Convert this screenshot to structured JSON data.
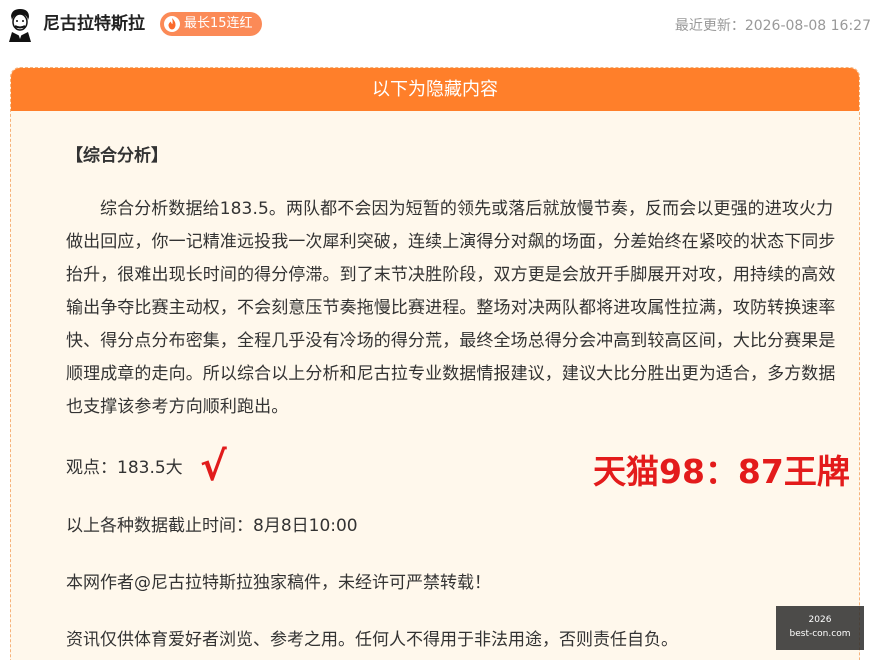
{
  "header": {
    "author_name": "尼古拉特斯拉",
    "streak_badge": "最长15连红",
    "update_label": "最近更新：",
    "update_time": "2026-08-08 16:27"
  },
  "panel": {
    "heading": "以下为隐藏内容",
    "section_title": "【综合分析】",
    "analysis": "综合分析数据给183.5。两队都不会因为短暂的领先或落后就放慢节奏，反而会以更强的进攻火力做出回应，你一记精准远投我一次犀利突破，连续上演得分对飙的场面，分差始终在紧咬的状态下同步抬升，很难出现长时间的得分停滞。到了末节决胜阶段，双方更是会放开手脚展开对攻，用持续的高效输出争夺比赛主动权，不会刻意压节奏拖慢比赛进程。整场对决两队都将进攻属性拉满，攻防转换速率快、得分点分布密集，全程几乎没有冷场的得分荒，最终全场总得分会冲高到较高区间，大比分赛果是顺理成章的走向。所以综合以上分析和尼古拉专业数据情报建议，建议大比分胜出更为适合，多方数据也支撑该参考方向顺利跑出。",
    "opinion": "观点：183.5大",
    "check_mark": "√",
    "result": "天猫98：87王牌",
    "deadline": "以上各种数据截止时间：8月8日10:00",
    "copyright": "本网作者@尼古拉特斯拉独家稿件，未经许可严禁转载！",
    "disclaimer": "资讯仅供体育爱好者浏览、参考之用。任何人不得用于非法用途，否则责任自负。"
  },
  "watermark": {
    "line1": "2026",
    "line2": "best-con.com"
  },
  "colors": {
    "accent": "#ff7f2a",
    "badge": "#fb8a57",
    "panel_bg": "#fff8ec",
    "result_red": "#e31b1b"
  }
}
